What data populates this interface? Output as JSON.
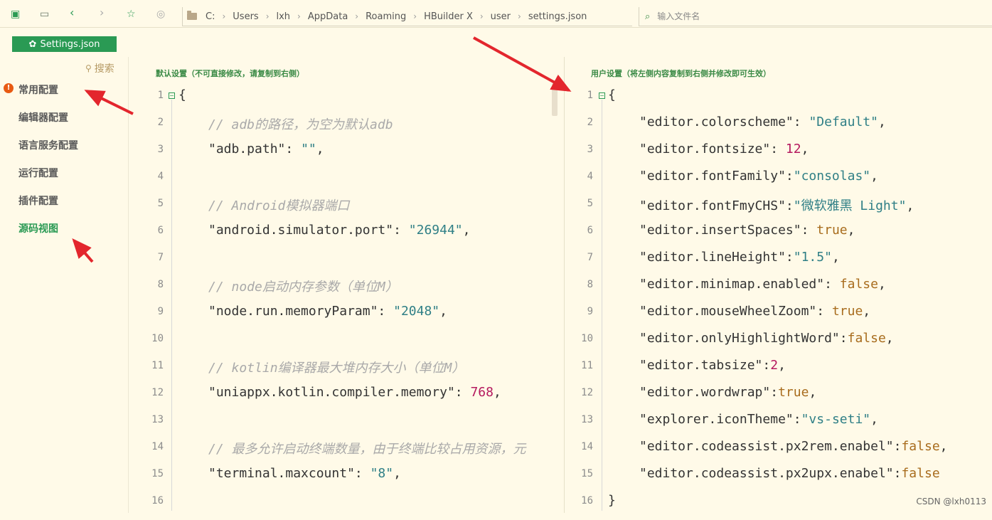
{
  "toolbar": {
    "path": [
      "C:",
      "Users",
      "lxh",
      "AppData",
      "Roaming",
      "HBuilder X",
      "user",
      "settings.json"
    ],
    "file_search_placeholder": "输入文件名"
  },
  "tab": {
    "label": "Settings.json"
  },
  "nav": {
    "search_label": "搜索",
    "items": [
      "常用配置",
      "编辑器配置",
      "语言服务配置",
      "运行配置",
      "插件配置",
      "源码视图"
    ],
    "active_index": 5
  },
  "default_pane": {
    "title": "默认设置（不可直接修改，请复制到右侧）",
    "lines": [
      [
        [
          "p",
          "{"
        ]
      ],
      [
        [
          "c",
          "// adb的路径，为空为默认adb"
        ]
      ],
      [
        [
          "k",
          "\"adb.path\""
        ],
        [
          "p",
          ": "
        ],
        [
          "s",
          "\"\""
        ],
        [
          "p",
          ","
        ]
      ],
      [],
      [
        [
          "c",
          "// Android模拟器端口"
        ]
      ],
      [
        [
          "k",
          "\"android.simulator.port\""
        ],
        [
          "p",
          ": "
        ],
        [
          "s",
          "\"26944\""
        ],
        [
          "p",
          ","
        ]
      ],
      [],
      [
        [
          "c",
          "// node启动内存参数（单位M）"
        ]
      ],
      [
        [
          "k",
          "\"node.run.memoryParam\""
        ],
        [
          "p",
          ": "
        ],
        [
          "s",
          "\"2048\""
        ],
        [
          "p",
          ","
        ]
      ],
      [],
      [
        [
          "c",
          "// kotlin编译器最大堆内存大小（单位M）"
        ]
      ],
      [
        [
          "k",
          "\"uniappx.kotlin.compiler.memory\""
        ],
        [
          "p",
          ": "
        ],
        [
          "n",
          "768"
        ],
        [
          "p",
          ","
        ]
      ],
      [],
      [
        [
          "c",
          "// 最多允许启动终端数量，由于终端比较占用资源，元"
        ]
      ],
      [
        [
          "k",
          "\"terminal.maxcount\""
        ],
        [
          "p",
          ": "
        ],
        [
          "s",
          "\"8\""
        ],
        [
          "p",
          ","
        ]
      ],
      []
    ]
  },
  "user_pane": {
    "title": "用户设置（将左侧内容复制到右侧并修改即可生效）",
    "lines": [
      [
        [
          "p",
          "{"
        ]
      ],
      [
        [
          "k",
          "\"editor.colorscheme\""
        ],
        [
          "p",
          ": "
        ],
        [
          "s",
          "\"Default\""
        ],
        [
          "p",
          ","
        ]
      ],
      [
        [
          "k",
          "\"editor.fontsize\""
        ],
        [
          "p",
          ": "
        ],
        [
          "n",
          "12"
        ],
        [
          "p",
          ","
        ]
      ],
      [
        [
          "k",
          "\"editor.fontFamily\""
        ],
        [
          "p",
          ":"
        ],
        [
          "s",
          "\"consolas\""
        ],
        [
          "p",
          ","
        ]
      ],
      [
        [
          "k",
          "\"editor.fontFmyCHS\""
        ],
        [
          "p",
          ":"
        ],
        [
          "s",
          "\"微软雅黑 Light\""
        ],
        [
          "p",
          ","
        ]
      ],
      [
        [
          "k",
          "\"editor.insertSpaces\""
        ],
        [
          "p",
          ": "
        ],
        [
          "b",
          "true"
        ],
        [
          "p",
          ","
        ]
      ],
      [
        [
          "k",
          "\"editor.lineHeight\""
        ],
        [
          "p",
          ":"
        ],
        [
          "s",
          "\"1.5\""
        ],
        [
          "p",
          ","
        ]
      ],
      [
        [
          "k",
          "\"editor.minimap.enabled\""
        ],
        [
          "p",
          ": "
        ],
        [
          "b",
          "false"
        ],
        [
          "p",
          ","
        ]
      ],
      [
        [
          "k",
          "\"editor.mouseWheelZoom\""
        ],
        [
          "p",
          ": "
        ],
        [
          "b",
          "true"
        ],
        [
          "p",
          ","
        ]
      ],
      [
        [
          "k",
          "\"editor.onlyHighlightWord\""
        ],
        [
          "p",
          ":"
        ],
        [
          "b",
          "false"
        ],
        [
          "p",
          ","
        ]
      ],
      [
        [
          "k",
          "\"editor.tabsize\""
        ],
        [
          "p",
          ":"
        ],
        [
          "n",
          "2"
        ],
        [
          "p",
          ","
        ]
      ],
      [
        [
          "k",
          "\"editor.wordwrap\""
        ],
        [
          "p",
          ":"
        ],
        [
          "b",
          "true"
        ],
        [
          "p",
          ","
        ]
      ],
      [
        [
          "k",
          "\"explorer.iconTheme\""
        ],
        [
          "p",
          ":"
        ],
        [
          "s",
          "\"vs-seti\""
        ],
        [
          "p",
          ","
        ]
      ],
      [
        [
          "k",
          "\"editor.codeassist.px2rem.enabel\""
        ],
        [
          "p",
          ":"
        ],
        [
          "b",
          "false"
        ],
        [
          "p",
          ","
        ]
      ],
      [
        [
          "k",
          "\"editor.codeassist.px2upx.enabel\""
        ],
        [
          "p",
          ":"
        ],
        [
          "b",
          "false"
        ]
      ],
      [
        [
          "p",
          "}"
        ]
      ]
    ]
  },
  "watermark": "CSDN @lxh0113",
  "colors": {
    "accent": "#2a9a54",
    "string": "#2f7f86",
    "number": "#b5195e",
    "boolean": "#a86c1d",
    "comment": "#a9a9a9",
    "arrow": "#e3262d"
  }
}
